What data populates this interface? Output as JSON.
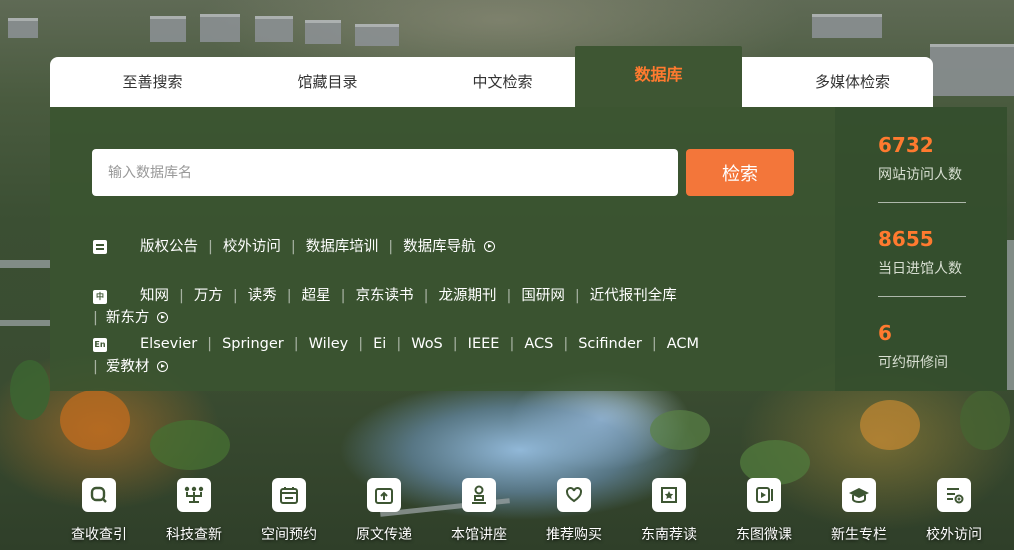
{
  "tabs": [
    {
      "label": "至善搜索",
      "active": false
    },
    {
      "label": "馆藏目录",
      "active": false
    },
    {
      "label": "中文检索",
      "active": false
    },
    {
      "label": "数据库",
      "active": true
    },
    {
      "label": "多媒体检索",
      "active": false
    }
  ],
  "search": {
    "placeholder": "输入数据库名",
    "value": "",
    "button_label": "检索"
  },
  "row1": {
    "icon": "document-lines-icon",
    "links": [
      "版权公告",
      "校外访问",
      "数据库培训",
      "数据库导航"
    ]
  },
  "row2": {
    "icon_text": "中",
    "links": [
      "知网",
      "万方",
      "读秀",
      "超星",
      "京东读书",
      "龙源期刊",
      "国研网",
      "近代报刊全库"
    ],
    "wrap_links": [
      "新东方"
    ]
  },
  "row3": {
    "icon_text": "En",
    "links": [
      "Elsevier",
      "Springer",
      "Wiley",
      "Ei",
      "WoS",
      "IEEE",
      "ACS",
      "Scifinder",
      "ACM"
    ],
    "wrap_links": [
      "爱教材"
    ]
  },
  "stats": [
    {
      "value": "6732",
      "label": "网站访问人数"
    },
    {
      "value": "8655",
      "label": "当日进馆人数"
    },
    {
      "value": "6",
      "label": "可约研修间"
    }
  ],
  "quick_links": [
    {
      "label": "查收查引",
      "icon": "search-icon"
    },
    {
      "label": "科技查新",
      "icon": "network-icon"
    },
    {
      "label": "空间预约",
      "icon": "calendar-icon"
    },
    {
      "label": "原文传递",
      "icon": "upload-icon"
    },
    {
      "label": "本馆讲座",
      "icon": "speaker-icon"
    },
    {
      "label": "推荐购买",
      "icon": "heart-icon"
    },
    {
      "label": "东南荐读",
      "icon": "book-star-icon"
    },
    {
      "label": "东图微课",
      "icon": "play-icon"
    },
    {
      "label": "新生专栏",
      "icon": "graduation-cap-icon"
    },
    {
      "label": "校外访问",
      "icon": "remote-access-icon"
    }
  ],
  "colors": {
    "accent": "#ff7a2f",
    "panel": "#3e5633",
    "button": "#f3763a"
  }
}
